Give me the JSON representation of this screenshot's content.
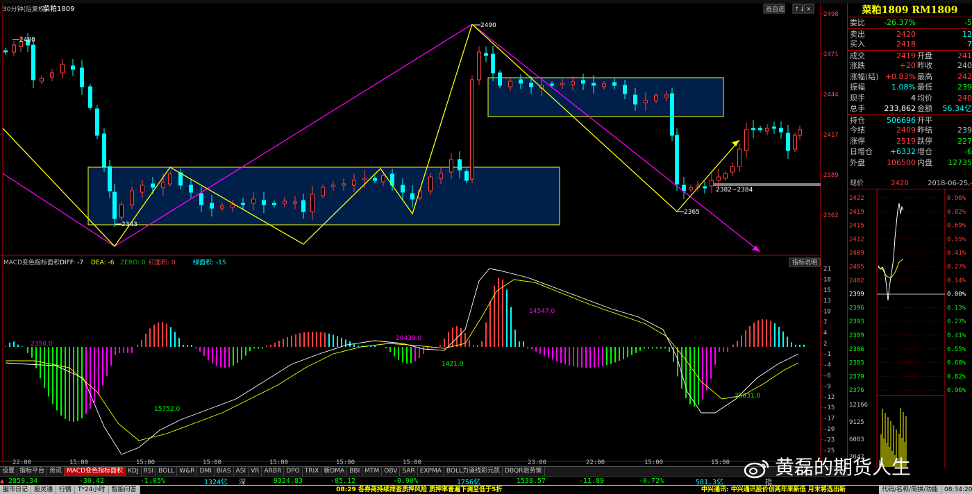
{
  "chart_header": {
    "period": "30分钟(后复权)",
    "symbol": "菜粕1809",
    "buttons": [
      "画自选",
      "↑↓",
      "✕"
    ]
  },
  "price_axis": [
    "2498",
    "2471",
    "2444",
    "2417",
    "2389",
    "2362"
  ],
  "annotations": {
    "high_2480": "2480",
    "low_2343": "2343",
    "high_2490": "2490",
    "low_2365": "2365",
    "range_2382_2384": "2382~2384"
  },
  "macd": {
    "header": {
      "name": "MACD变色指标面积",
      "diff": "DIFF: -7",
      "dea": "DEA: -6",
      "zero": "ZERO: 0",
      "red_area": "红面积: 0",
      "green_area": "绿面积: -15"
    },
    "button": "指标说明",
    "axis": [
      "21",
      "18",
      "15",
      "13",
      "10",
      "7",
      "4",
      "2",
      "-1",
      "-4",
      "-6",
      "-9",
      "-12",
      "-15",
      "-17",
      "-20",
      "-23",
      "-25"
    ],
    "labels": [
      "2350.0",
      "15752.0",
      "20439.0",
      "1421.0",
      "14547.0",
      "25831.0"
    ]
  },
  "time_axis": [
    "22:00",
    "15:00",
    "15:00",
    "15:00",
    "15:00",
    "15:00",
    "15:00",
    "23:00",
    "22:00",
    "15:00",
    "15:00"
  ],
  "tabs": [
    "设置",
    "指标平台",
    "资讯",
    "MACD变色指标面积",
    "KDJ",
    "RSI",
    "BOLL",
    "W&R",
    "DMI",
    "BIAS",
    "ASI",
    "VR",
    "ARBR",
    "DPO",
    "TRIX",
    "新DMA",
    "BBI",
    "MTM",
    "OBV",
    "SAR",
    "EXPMA",
    "BOLL力道线彩元凯",
    "DBQR岩劳策"
  ],
  "index_bar": {
    "sh_value": "2859.34",
    "sh_change": "-30.42",
    "sh_pct": "-1.05%",
    "sh_vol": "1324亿",
    "sz_label": "深",
    "sz_value": "9324.83",
    "sz_change": "-85.12",
    "sz_pct": "-0.90%",
    "sz_vol": "1756亿",
    "cy_value": "1538.57",
    "cy_change": "-11.89",
    "cy_pct": "-0.72%",
    "cy_vol": "581.3亿",
    "extra": "指"
  },
  "status_bar": {
    "items": [
      "服市日记",
      "股灵通",
      "行情",
      "T*24小时",
      "智能问答"
    ],
    "news1": "08:29 各券商持续排查质押风险 质押率普遍下调至低于5折",
    "news2": "中兴通讯: 中兴通讯股价创两年来新低 月末将选出新",
    "right_items": [
      "代码/名称/简拼/功能"
    ],
    "clock": "08:34:20"
  },
  "quote_panel": {
    "title": "菜粕1809 RM1809",
    "rows": [
      {
        "k1": "委比",
        "v1": "-26.37%",
        "c1": "#00ff00",
        "k2": "",
        "v2": "-5",
        "c2": "#00ff00"
      },
      {
        "k1": "卖出",
        "v1": "2420",
        "c1": "#ff4040",
        "k2": "",
        "v2": "12",
        "c2": "#00ffff",
        "sep": true
      },
      {
        "k1": "买入",
        "v1": "2418",
        "c1": "#ff4040",
        "k2": "",
        "v2": "7",
        "c2": "#00ffff"
      },
      {
        "k1": "成交",
        "v1": "2419",
        "c1": "#ff4040",
        "k2": "开盘",
        "v2": "241",
        "c2": "#ff4040",
        "sep": true
      },
      {
        "k1": "涨跌",
        "v1": "+20",
        "c1": "#ff4040",
        "k2": "昨收",
        "v2": "240",
        "c2": "#c0c0c0"
      },
      {
        "k1": "涨幅(结)",
        "v1": "+0.83%",
        "c1": "#ff4040",
        "k2": "最高",
        "v2": "242",
        "c2": "#ff4040"
      },
      {
        "k1": "振幅",
        "v1": "1.08%",
        "c1": "#00ffff",
        "k2": "最低",
        "v2": "239",
        "c2": "#00ff00"
      },
      {
        "k1": "现手",
        "v1": "4",
        "c1": "#ffffff",
        "k2": "均价",
        "v2": "240",
        "c2": "#ff4040"
      },
      {
        "k1": "总手",
        "v1": "233,862",
        "c1": "#ffffff",
        "k2": "金额",
        "v2": "56.34亿",
        "c2": "#00ffff"
      },
      {
        "k1": "持仓",
        "v1": "506696",
        "c1": "#00ffff",
        "k2": "开平",
        "v2": "",
        "c2": "#c0c0c0",
        "sep": true
      },
      {
        "k1": "今结",
        "v1": "2409",
        "c1": "#ff4040",
        "k2": "昨结",
        "v2": "239",
        "c2": "#c0c0c0"
      },
      {
        "k1": "涨停",
        "v1": "2519",
        "c1": "#ff4040",
        "k2": "跌停",
        "v2": "227",
        "c2": "#00ff00"
      },
      {
        "k1": "日增仓",
        "v1": "+6332",
        "c1": "#00ffff",
        "k2": "增仓",
        "v2": "-6",
        "c2": "#00ff00"
      },
      {
        "k1": "外盘",
        "v1": "106500",
        "c1": "#ff4040",
        "k2": "内盘",
        "v2": "12735",
        "c2": "#00ff00"
      }
    ]
  },
  "tick_panel": {
    "label": "现价",
    "price": "2420",
    "date": "2018-06-25,-",
    "left_axis": [
      "2422",
      "2419",
      "2415",
      "2412",
      "2409",
      "2405",
      "2402",
      "2399",
      "2396",
      "2393",
      "2389",
      "2386",
      "2383",
      "2379",
      "2376",
      "12166",
      "9125",
      "6083",
      "3042"
    ],
    "right_axis": [
      "0.96%",
      "0.82%",
      "0.69%",
      "0.55%",
      "0.41%",
      "0.27%",
      "0.14%",
      "0.00%",
      "0.13%",
      "0.27%",
      "0.41%",
      "0.55%",
      "0.68%",
      "0.82%",
      "0.96%"
    ]
  },
  "watermark": "黄磊的期货人生",
  "colors": {
    "up": "#ff4040",
    "down": "#00ffff",
    "box_fill": "#00204a",
    "box_border": "#ffff00",
    "trend_magenta": "#ff00ff",
    "trend_yellow": "#ffff00"
  }
}
